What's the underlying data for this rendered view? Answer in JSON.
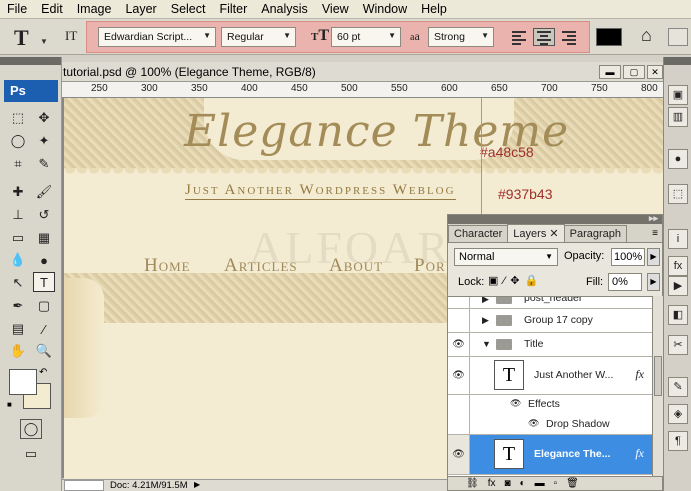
{
  "menu": [
    "File",
    "Edit",
    "Image",
    "Layer",
    "Select",
    "Filter",
    "Analysis",
    "View",
    "Window",
    "Help"
  ],
  "options": {
    "tool_glyph": "T",
    "orientation_glyph": "IT",
    "font_family": "Edwardian Script...",
    "font_style": "Regular",
    "size_glyph": "T",
    "font_size": "60 pt",
    "aa_glyph": "a",
    "aa_glyph2": "a",
    "antialias": "Strong",
    "text_color": "#000000",
    "highlight_color": "#eab3ad"
  },
  "tools_panel": {
    "logo": "Ps",
    "foreground": "#ffffff",
    "background": "#f3ecd1"
  },
  "document": {
    "title": "tutorial.psd @ 100% (Elegance Theme, RGB/8)",
    "ruler_labels": [
      "250",
      "300",
      "350",
      "400",
      "450",
      "500",
      "550",
      "600",
      "650",
      "700",
      "750",
      "800"
    ],
    "canvas": {
      "logo_text": "Elegance Theme",
      "logo_color": "#a48c58",
      "annotation1": "#a48c58",
      "tagline": "Just Another Wordpress Weblog",
      "tagline_color": "#937b43",
      "annotation2": "#937b43",
      "watermark": "ALFOART",
      "nav": [
        "Home",
        "Articles",
        "About",
        "Por"
      ]
    },
    "status": "Doc: 4.21M/91.5M"
  },
  "layers_panel": {
    "tabs": [
      "Character",
      "Layers",
      "Paragraph"
    ],
    "active_tab": "Layers",
    "blend_mode": "Normal",
    "opacity_label": "Opacity:",
    "opacity": "100%",
    "lock_label": "Lock:",
    "fill_label": "Fill:",
    "fill": "0%",
    "layers": [
      {
        "name": "post_header",
        "type": "group",
        "visible": false
      },
      {
        "name": "Group 17 copy",
        "type": "group",
        "visible": false
      },
      {
        "name": "Title",
        "type": "group",
        "visible": true,
        "expanded": true
      },
      {
        "name": "Just Another W...",
        "type": "text",
        "visible": true,
        "fx": "fx"
      },
      {
        "name": "Effects",
        "type": "effects"
      },
      {
        "name": "Drop Shadow",
        "type": "effect"
      },
      {
        "name": "Elegance The...",
        "type": "text",
        "visible": true,
        "fx": "fx",
        "selected": true
      }
    ]
  }
}
